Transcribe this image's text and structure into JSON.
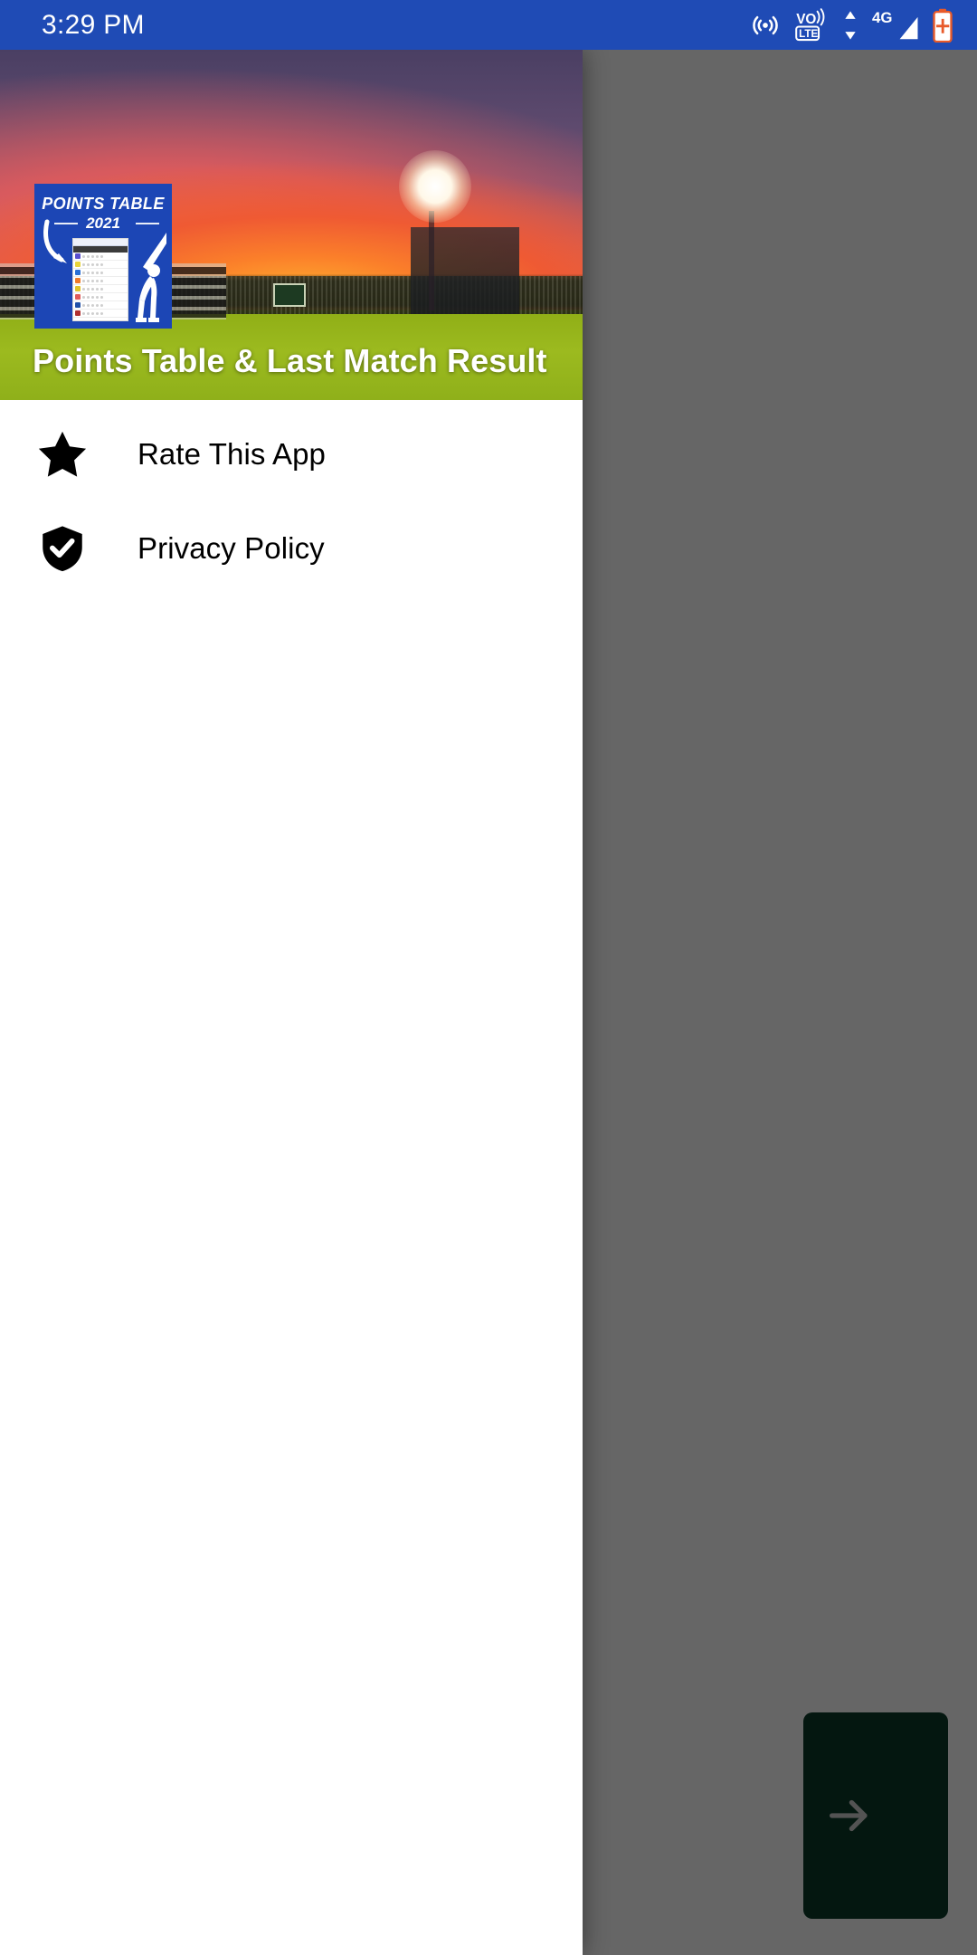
{
  "statusbar": {
    "time": "3:29 PM",
    "background": "#1f4bb5",
    "icons": [
      {
        "name": "hotspot-icon",
        "label": "hotspot"
      },
      {
        "name": "volte-icon",
        "label": "VoLTE"
      },
      {
        "name": "data-transfer-icon",
        "label": "data-arrows"
      },
      {
        "name": "signal-4g-icon",
        "label": "4G"
      },
      {
        "name": "battery-charging-icon",
        "label": "battery"
      }
    ],
    "volte_top": "VO",
    "volte_bottom": "LTE",
    "network_type": "4G"
  },
  "drawer": {
    "header": {
      "title": "Points Table & Last Match Result",
      "app_icon": {
        "name": "points-table-app-icon",
        "title": "POINTS TABLE",
        "year": "2021",
        "background": "#1c46b5"
      },
      "background_image": "cricket-stadium-sunset"
    },
    "items": [
      {
        "label": "Rate This App",
        "icon": "star-icon",
        "name": "drawer-item-rate-this-app"
      },
      {
        "label": "Privacy Policy",
        "icon": "shield-check-icon",
        "name": "drawer-item-privacy-policy"
      }
    ]
  },
  "background_app": {
    "fab": {
      "name": "next-arrow-button",
      "icon": "arrow-right-icon",
      "color": "#0a3a2a"
    }
  },
  "colors": {
    "statusbar": "#1f4bb5",
    "drawer_background": "#ffffff",
    "scrim": "rgba(0,0,0,0.6)",
    "accent_green": "#0a3a2a",
    "icon_black": "#000000"
  }
}
